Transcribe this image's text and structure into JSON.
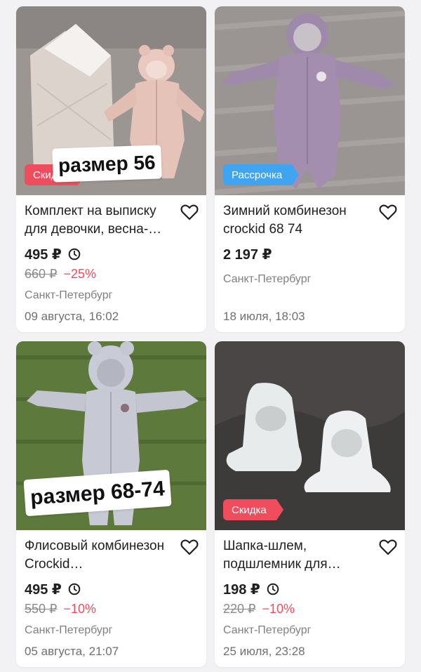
{
  "listings": [
    {
      "title": "Комплект на выписку для девочки, весна-…",
      "price": "495 ₽",
      "old_price": "660 ₽",
      "discount": "−25%",
      "city": "Санкт-Петербург",
      "date": "09 августа, 16:02",
      "badge": "Скидка",
      "sticker": "размер 56",
      "has_clock": true
    },
    {
      "title": "Зимний комбинезон crockid 68 74",
      "price": "2 197 ₽",
      "city": "Санкт-Петербург",
      "date": "18 июля, 18:03",
      "badge": "Рассрочка",
      "has_clock": false
    },
    {
      "title": "Флисовый комбинезон Crockid…",
      "price": "495 ₽",
      "old_price": "550 ₽",
      "discount": "−10%",
      "city": "Санкт-Петербург",
      "date": "05 августа, 21:07",
      "sticker": "размер 68-74",
      "has_clock": true
    },
    {
      "title": "Шапка-шлем, подшлемник для…",
      "price": "198 ₽",
      "old_price": "220 ₽",
      "discount": "−10%",
      "city": "Санкт-Петербург",
      "date": "25 июля, 23:28",
      "badge": "Скидка",
      "has_clock": true
    }
  ],
  "colors": {
    "discount_red": "#ef4d5e",
    "installment_blue": "#3fa5f3",
    "text": "#1f1f1f",
    "muted": "#7f7f7f"
  },
  "icons": {
    "favorite": "heart-outline-icon",
    "timer": "clock-icon"
  }
}
